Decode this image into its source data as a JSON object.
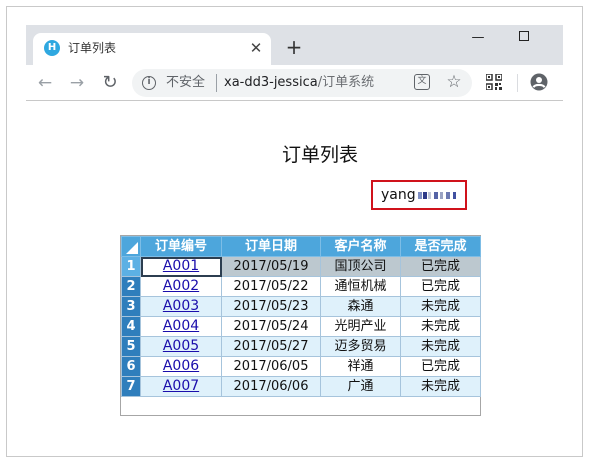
{
  "browser": {
    "tab_title": "订单列表",
    "tab_favicon_letter": "H",
    "tab_close": "✕",
    "new_tab": "+",
    "insecure_label": "不安全",
    "url_host": "xa-dd3-jessica",
    "url_path": "/订单系统",
    "info_glyph": "i",
    "translate_glyph": "文",
    "star_glyph": "☆",
    "back_glyph": "←",
    "forward_glyph": "→",
    "reload_glyph": "↻",
    "minimize_glyph": "—"
  },
  "page": {
    "title": "订单列表",
    "user_name": "yang"
  },
  "grid": {
    "headers": [
      "订单编号",
      "订单日期",
      "客户名称",
      "是否完成"
    ],
    "rows": [
      {
        "num": "1",
        "id": "A001",
        "date": "2017/05/19",
        "customer": "国顶公司",
        "status": "已完成"
      },
      {
        "num": "2",
        "id": "A002",
        "date": "2017/05/22",
        "customer": "通恒机械",
        "status": "已完成"
      },
      {
        "num": "3",
        "id": "A003",
        "date": "2017/05/23",
        "customer": "森通",
        "status": "未完成"
      },
      {
        "num": "4",
        "id": "A004",
        "date": "2017/05/24",
        "customer": "光明产业",
        "status": "未完成"
      },
      {
        "num": "5",
        "id": "A005",
        "date": "2017/05/27",
        "customer": "迈多贸易",
        "status": "未完成"
      },
      {
        "num": "6",
        "id": "A006",
        "date": "2017/06/05",
        "customer": "祥通",
        "status": "已完成"
      },
      {
        "num": "7",
        "id": "A007",
        "date": "2017/06/06",
        "customer": "广通",
        "status": "未完成"
      }
    ],
    "selected_row": 1
  },
  "colors": {
    "header_bg": "#4da6dc",
    "rownum_bg": "#2f7ebc",
    "odd_row_bg": "#dff1fb",
    "selected_row_bg": "#bcc8cf",
    "user_box_border": "#d0121b",
    "link": "#1a0dab"
  }
}
